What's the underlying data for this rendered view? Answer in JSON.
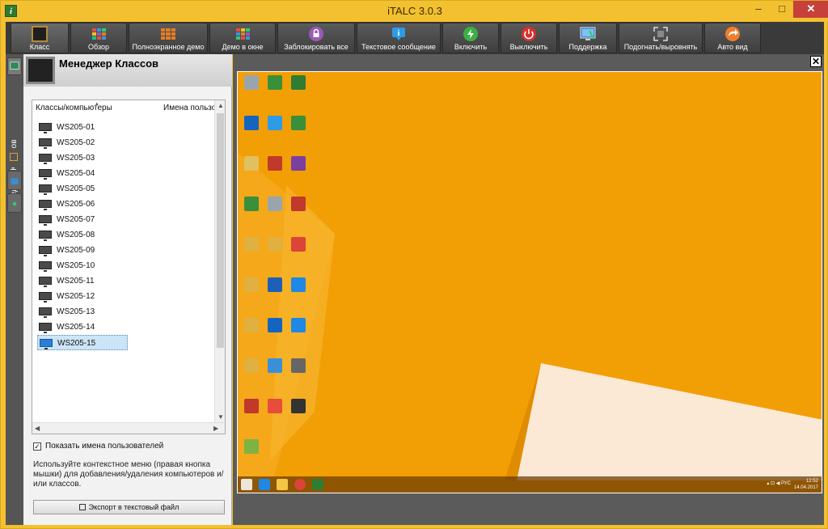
{
  "window": {
    "title": "iTALC 3.0.3",
    "app_icon": "i"
  },
  "window_controls": {
    "minimize": "–",
    "maximize": "□",
    "close": "✕"
  },
  "toolbar": [
    {
      "name": "class",
      "label": "Класс",
      "icon": "classroom-icon"
    },
    {
      "name": "overview",
      "label": "Обзор",
      "icon": "grid-icon"
    },
    {
      "name": "fullscreen-demo",
      "label": "Полноэкранное демо",
      "icon": "fullscreen-demo-icon"
    },
    {
      "name": "window-demo",
      "label": "Демо в окне",
      "icon": "window-demo-icon"
    },
    {
      "name": "lock-all",
      "label": "Заблокировать все",
      "icon": "lock-icon"
    },
    {
      "name": "text-message",
      "label": "Текстовое сообщение",
      "icon": "info-icon"
    },
    {
      "name": "power-on",
      "label": "Включить",
      "icon": "power-on-icon"
    },
    {
      "name": "power-off",
      "label": "Выключить",
      "icon": "power-off-icon"
    },
    {
      "name": "support",
      "label": "Поддержка",
      "icon": "support-icon"
    },
    {
      "name": "fit-align",
      "label": "Подогнать/выровнять",
      "icon": "fit-icon"
    },
    {
      "name": "auto-view",
      "label": "Авто вид",
      "icon": "auto-view-icon"
    }
  ],
  "sidebar": {
    "vertical_label": "Менеджер Классов"
  },
  "panel": {
    "title": "Менеджер Классов",
    "columns": [
      "Классы/компьютеры",
      "Имена пользо"
    ],
    "computers": [
      "WS205-01",
      "WS205-02",
      "WS205-03",
      "WS205-04",
      "WS205-05",
      "WS205-06",
      "WS205-07",
      "WS205-08",
      "WS205-09",
      "WS205-10",
      "WS205-11",
      "WS205-12",
      "WS205-13",
      "WS205-14",
      "WS205-15"
    ],
    "selected": "WS205-15",
    "show_usernames_label": "Показать имена пользователей",
    "show_usernames_checked": true,
    "hint": "Используйте контекстное меню (правая кнопка мышки) для добавления/удаления компьютеров и/или классов.",
    "export_label": "Экспорт в текстовый файл"
  },
  "remote": {
    "close_label": "✕",
    "clock_time": "12:52",
    "clock_date": "14.04.2017",
    "tray_lang": "РУС"
  },
  "colors": {
    "accent": "#f3c02f",
    "desktop": "#f29f05",
    "selected_row": "#cce4f7"
  }
}
